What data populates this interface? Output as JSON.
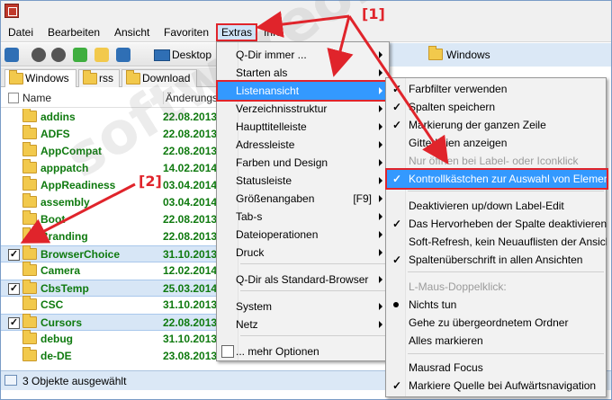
{
  "menubar": {
    "items": [
      "Datei",
      "Bearbeiten",
      "Ansicht",
      "Favoriten",
      "Extras",
      "Info"
    ]
  },
  "toolbar": {
    "desktop_label": "Desktop",
    "path_label": "Windows"
  },
  "tabs": [
    "Windows",
    "rss",
    "Download"
  ],
  "list": {
    "header_name": "Name",
    "header_date": "Änderungs",
    "rows": [
      {
        "name": "addins",
        "date": "22.08.2013",
        "checked": false
      },
      {
        "name": "ADFS",
        "date": "22.08.2013",
        "checked": false
      },
      {
        "name": "AppCompat",
        "date": "22.08.2013",
        "checked": false
      },
      {
        "name": "apppatch",
        "date": "14.02.2014",
        "checked": false
      },
      {
        "name": "AppReadiness",
        "date": "03.04.2014",
        "checked": false
      },
      {
        "name": "assembly",
        "date": "03.04.2014",
        "checked": false
      },
      {
        "name": "Boot",
        "date": "22.08.2013",
        "checked": false
      },
      {
        "name": "Branding",
        "date": "22.08.2013",
        "checked": false
      },
      {
        "name": "BrowserChoice",
        "date": "31.10.2013",
        "checked": true
      },
      {
        "name": "Camera",
        "date": "12.02.2014",
        "checked": false
      },
      {
        "name": "CbsTemp",
        "date": "25.03.2014",
        "checked": true
      },
      {
        "name": "CSC",
        "date": "31.10.2013",
        "checked": false
      },
      {
        "name": "Cursors",
        "date": "22.08.2013",
        "checked": true
      },
      {
        "name": "debug",
        "date": "31.10.2013",
        "checked": false
      },
      {
        "name": "de-DE",
        "date": "23.08.2013",
        "checked": false
      }
    ]
  },
  "status": {
    "text": "3 Objekte ausgewählt"
  },
  "extras_menu": {
    "items": [
      {
        "label": "Q-Dir immer ...",
        "submenu": true
      },
      {
        "label": "Starten als",
        "submenu": true
      },
      {
        "label": "Listenansicht",
        "submenu": true,
        "highlighted": true
      },
      {
        "label": "Verzeichnisstruktur",
        "submenu": true
      },
      {
        "label": "Haupttitelleiste",
        "submenu": true
      },
      {
        "label": "Adressleiste",
        "submenu": true
      },
      {
        "label": "Farben und Design",
        "submenu": true
      },
      {
        "label": "Statusleiste",
        "submenu": true
      },
      {
        "label": "Größenangaben",
        "shortcut": "[F9]",
        "submenu": true
      },
      {
        "label": "Tab-s",
        "submenu": true
      },
      {
        "label": "Dateioperationen",
        "submenu": true
      },
      {
        "label": "Druck",
        "submenu": true
      },
      {
        "label": "Q-Dir als Standard-Browser",
        "submenu": true
      },
      {
        "label": "System",
        "submenu": true
      },
      {
        "label": "Netz",
        "submenu": true
      },
      {
        "label": "... mehr Optionen",
        "submenu": false
      }
    ]
  },
  "list_menu": {
    "items": [
      {
        "label": "Farbfilter verwenden",
        "check": true
      },
      {
        "label": "Spalten speichern",
        "check": true
      },
      {
        "label": "Markierung der ganzen Zeile",
        "check": true
      },
      {
        "label": "Gitterlinien anzeigen",
        "check": false
      },
      {
        "label": "Nur öffnen bei Label- oder Iconklick",
        "check": false,
        "disabled": true
      },
      {
        "label": "Kontrollkästchen zur Auswahl von Elementen",
        "check": true,
        "highlighted": true
      },
      {
        "label": "Deaktivieren up/down Label-Edit",
        "check": false
      },
      {
        "label": "Das Hervorheben der Spalte deaktivieren (W7)",
        "check": true
      },
      {
        "label": "Soft-Refresh, kein Neuauflisten der Ansicht",
        "check": false
      },
      {
        "label": "Spaltenüberschrift in allen Ansichten",
        "check": true
      },
      {
        "label": "L-Maus-Doppelklick:",
        "check": false,
        "disabled": true
      },
      {
        "label": "Nichts tun",
        "radio": true
      },
      {
        "label": "Gehe zu übergeordnetem Ordner",
        "check": false
      },
      {
        "label": "Alles markieren",
        "check": false
      },
      {
        "label": "Mausrad Focus",
        "check": false
      },
      {
        "label": "Markiere Quelle bei Aufwärtsnavigation",
        "check": true
      }
    ]
  },
  "annotations": {
    "label1": "[1]",
    "label2": "[2]",
    "color": "#e0242b"
  },
  "watermark": "softwareok.de"
}
